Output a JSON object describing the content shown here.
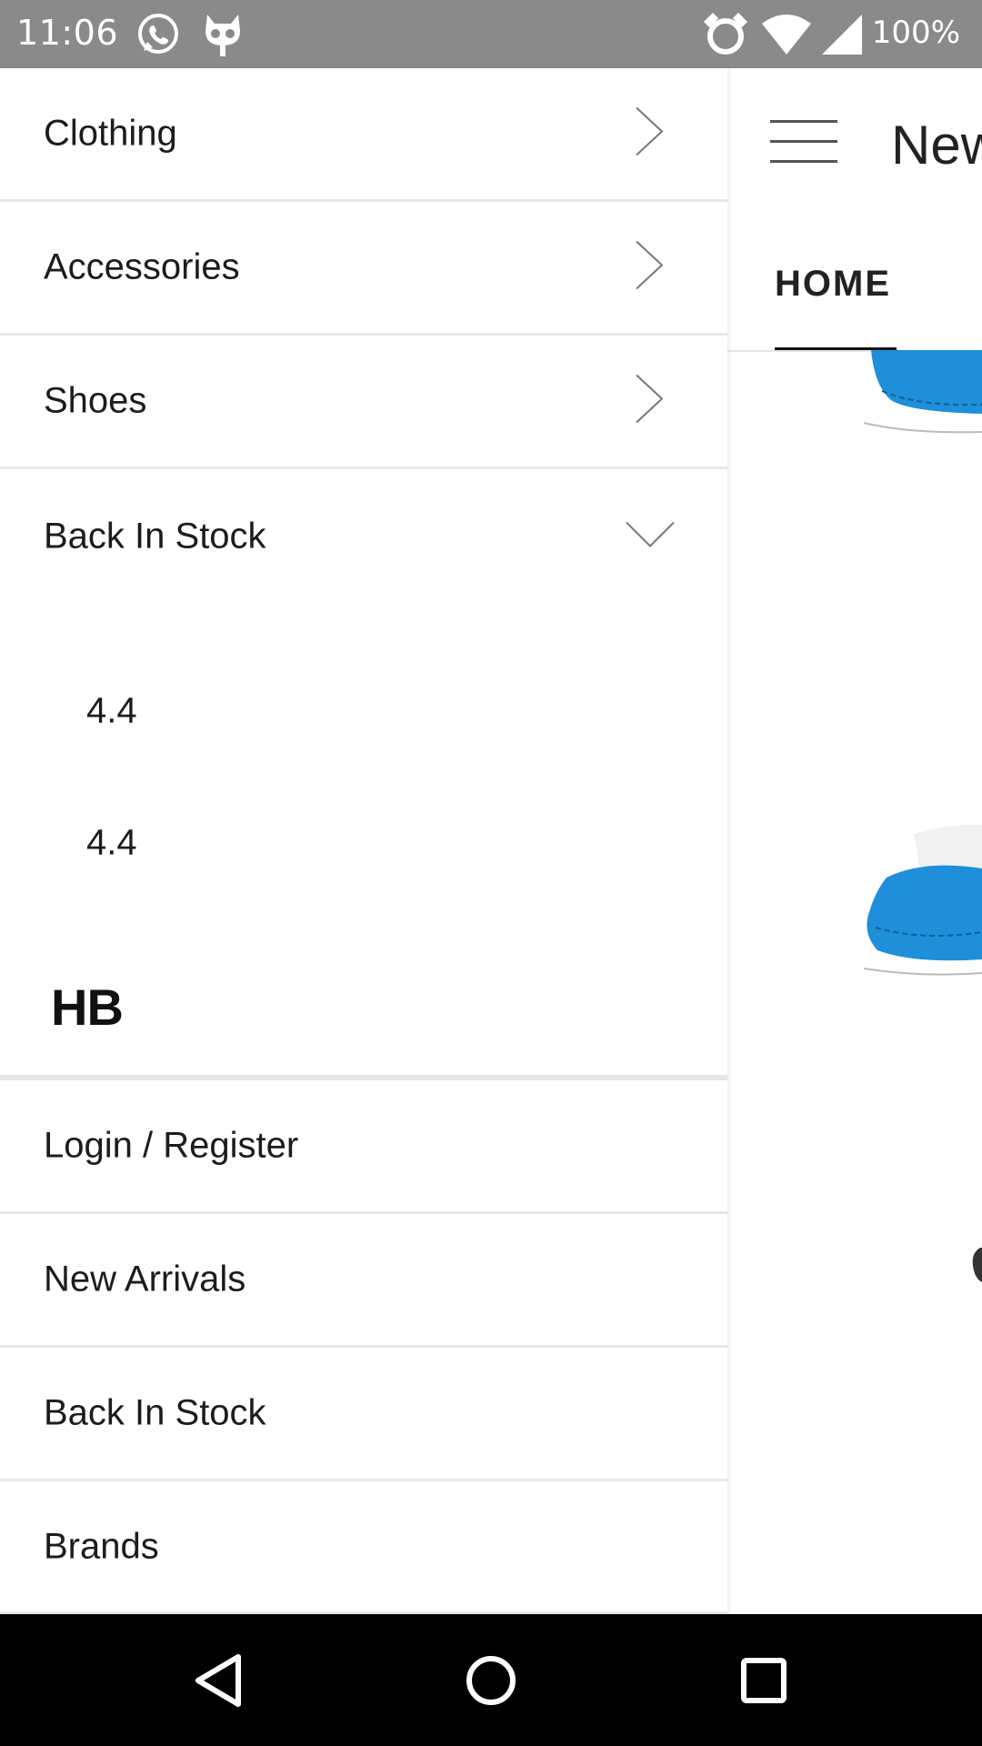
{
  "status_bar": {
    "time": "11:06",
    "battery": "100%",
    "icons": [
      "whatsapp-icon",
      "cyanogen-icon",
      "alarm-icon",
      "wifi-icon",
      "signal-icon"
    ]
  },
  "drawer": {
    "categories": [
      {
        "label": "Clothing",
        "icon": "chevron-right-icon"
      },
      {
        "label": "Accessories",
        "icon": "chevron-right-icon"
      },
      {
        "label": "Shoes",
        "icon": "chevron-right-icon"
      },
      {
        "label": "Back In Stock",
        "icon": "chevron-down-icon",
        "expanded": true
      }
    ],
    "subitems": [
      {
        "label": "4.4"
      },
      {
        "label": "4.4"
      }
    ],
    "brand_logo": "HB",
    "links": [
      {
        "label": "Login / Register"
      },
      {
        "label": "New Arrivals"
      },
      {
        "label": "Back In Stock"
      },
      {
        "label": "Brands"
      }
    ]
  },
  "background_app": {
    "title": "New",
    "tab": "HOME"
  },
  "nav_bar": {
    "buttons": [
      "back-icon",
      "home-icon",
      "recents-icon"
    ]
  }
}
